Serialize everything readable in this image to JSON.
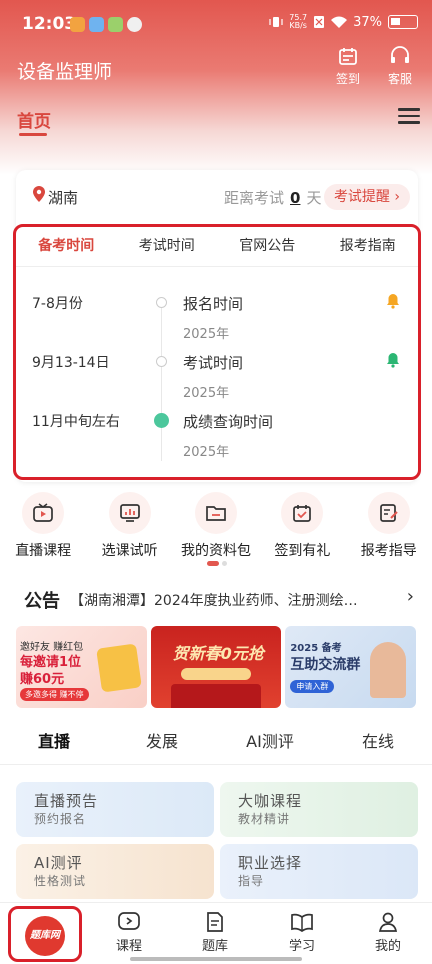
{
  "status_bar": {
    "time": "12:03",
    "net_speed_value": "75.7",
    "net_speed_unit": "KB/s",
    "battery": "37%"
  },
  "header": {
    "app_title": "设备监理师",
    "checkin_label": "签到",
    "service_label": "客服",
    "home_tab": "首页"
  },
  "exam_card": {
    "province": "湖南",
    "countdown_prefix": "距离考试",
    "countdown_days": "0",
    "countdown_unit": "天",
    "reminder_button": "考试提醒",
    "tabs": [
      "备考时间",
      "考试时间",
      "官网公告",
      "报考指南"
    ],
    "active_tab": 0,
    "timeline": [
      {
        "date": "7-8月份",
        "event": "报名时间",
        "year": "2025年",
        "bell": "orange"
      },
      {
        "date": "9月13-14日",
        "event": "考试时间",
        "year": "2025年",
        "bell": "green"
      },
      {
        "date": "11月中旬左右",
        "event": "成绩查询时间",
        "year": "2025年",
        "bell": ""
      }
    ]
  },
  "quick_entries": [
    {
      "label": "直播课程",
      "icon": "tv-play-icon"
    },
    {
      "label": "选课试听",
      "icon": "chart-screen-icon"
    },
    {
      "label": "我的资料包",
      "icon": "folder-icon"
    },
    {
      "label": "签到有礼",
      "icon": "calendar-check-icon"
    },
    {
      "label": "报考指导",
      "icon": "edit-note-icon"
    }
  ],
  "notice": {
    "tag": "公告",
    "text": "【湖南湘潭】2024年度执业药师、注册测绘…"
  },
  "banners": {
    "b1_line1": "邀好友 赚红包",
    "b1_line2": "每邀请1位",
    "b1_line3": "赚60元",
    "b1_pill": "多邀多得 赚不停",
    "b2_title": "贺新春0元抢",
    "b3_year": "2025 备考",
    "b3_title": "互助交流群",
    "b3_pill": "申请入群"
  },
  "content_tabs": [
    "直播",
    "发展",
    "AI测评",
    "在线"
  ],
  "content_cards": [
    {
      "title": "直播预告",
      "sub": "预约报名"
    },
    {
      "title": "大咖课程",
      "sub": "教材精讲"
    },
    {
      "title": "AI测评",
      "sub": "性格测试"
    },
    {
      "title": "职业选择",
      "sub": "指导"
    }
  ],
  "bottom_nav": {
    "logo_text": "题库网",
    "items": [
      "课程",
      "题库",
      "学习",
      "我的"
    ]
  },
  "colors": {
    "brand_red": "#e2574f",
    "active_red": "#d9473e",
    "highlight_border": "#d9202a",
    "bell_orange": "#f5a623",
    "bell_green": "#2bb673"
  }
}
